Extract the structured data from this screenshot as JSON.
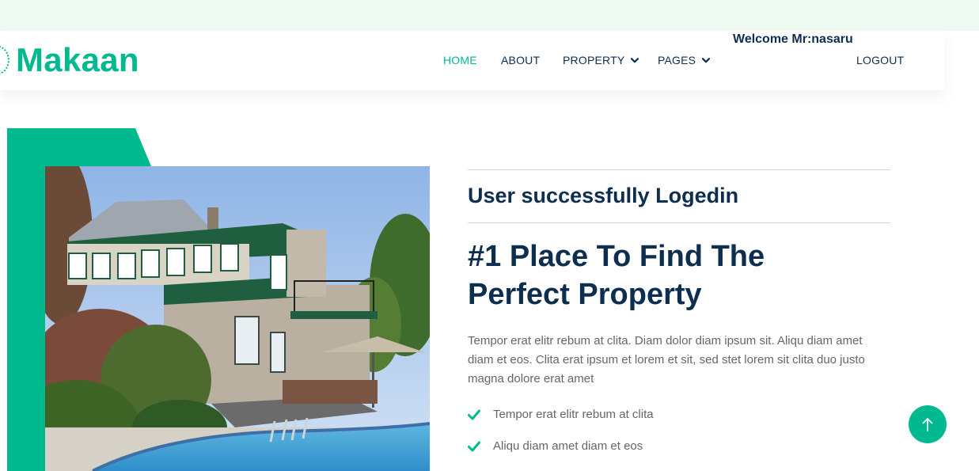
{
  "brand": {
    "name": "Makaan"
  },
  "nav": {
    "items": [
      {
        "label": "HOME",
        "active": true
      },
      {
        "label": "ABOUT"
      },
      {
        "label": "PROPERTY",
        "dropdown": true
      },
      {
        "label": "PAGES",
        "dropdown": true
      }
    ],
    "welcome": "Welcome Mr:nasaru",
    "logout": "LOGOUT"
  },
  "hero": {
    "status_message": "User successfully Logedin",
    "headline_line1": "#1 Place To Find The",
    "headline_line2": "Perfect Property",
    "paragraph": "Tempor erat elitr rebum at clita. Diam dolor diam ipsum sit. Aliqu diam amet diam et eos. Clita erat ipsum et lorem et sit, sed stet lorem sit clita duo justo magna dolore erat amet",
    "checks": [
      "Tempor erat elitr rebum at clita",
      "Aliqu diam amet diam et eos"
    ]
  },
  "colors": {
    "primary": "#00b98e",
    "dark": "#0e2e50",
    "text": "#666666",
    "top_band": "#eefaf2"
  },
  "icons": {
    "check": "check-icon",
    "chevron": "chevron-down-icon",
    "back_to_top": "arrow-up-icon",
    "logo": "logo-icon"
  }
}
